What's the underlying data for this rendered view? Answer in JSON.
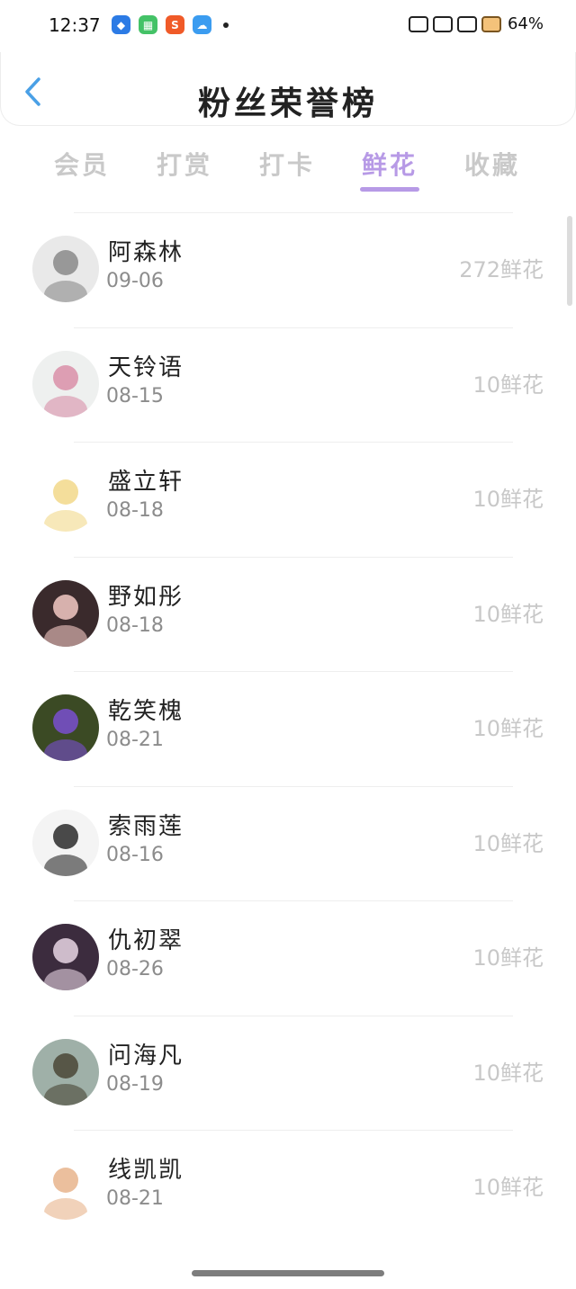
{
  "status_bar": {
    "time": "12:37",
    "battery": "64%",
    "app_icons": [
      {
        "name": "browser-icon",
        "color": "#2c7be5",
        "glyph": "◆"
      },
      {
        "name": "grid-app-icon",
        "color": "#44c267",
        "glyph": "▦"
      },
      {
        "name": "s-app-icon",
        "color": "#f05a28",
        "glyph": "S"
      },
      {
        "name": "weather-icon",
        "color": "#3b9cf0",
        "glyph": "☁"
      }
    ]
  },
  "header": {
    "title": "粉丝荣誉榜"
  },
  "tabs": [
    {
      "label": "会员",
      "active": false
    },
    {
      "label": "打赏",
      "active": false
    },
    {
      "label": "打卡",
      "active": false
    },
    {
      "label": "鲜花",
      "active": true
    },
    {
      "label": "收藏",
      "active": false
    }
  ],
  "colors": {
    "accent": "#b79ae6",
    "back_arrow": "#4aa0e6"
  },
  "fans": [
    {
      "name": "阿森林",
      "date": "09-06",
      "amount": "272鲜花",
      "avatar": "anime-girl-sketch-avatar",
      "bg": "#e9e9e9",
      "fg": "#8a8a8a"
    },
    {
      "name": "天铃语",
      "date": "08-15",
      "amount": "10鲜花",
      "avatar": "flower-earrings-avatar",
      "bg": "#eef0ef",
      "fg": "#d98fa8"
    },
    {
      "name": "盛立轩",
      "date": "08-18",
      "amount": "10鲜花",
      "avatar": "cute-chick-avatar",
      "bg": "#ffffff",
      "fg": "#f2d88a"
    },
    {
      "name": "野如彤",
      "date": "08-18",
      "amount": "10鲜花",
      "avatar": "illustrated-girl-avatar",
      "bg": "#3a2a2c",
      "fg": "#f3c9c4"
    },
    {
      "name": "乾笑槐",
      "date": "08-21",
      "amount": "10鲜花",
      "avatar": "purple-iris-avatar",
      "bg": "#3b4a24",
      "fg": "#7a4fd0"
    },
    {
      "name": "索雨莲",
      "date": "08-16",
      "amount": "10鲜花",
      "avatar": "tiger-sketch-avatar",
      "bg": "#f4f4f4",
      "fg": "#2a2a2a"
    },
    {
      "name": "仇初翠",
      "date": "08-26",
      "amount": "10鲜花",
      "avatar": "dark-anime-avatar",
      "bg": "#3c2c3e",
      "fg": "#e8d6e4"
    },
    {
      "name": "问海凡",
      "date": "08-19",
      "amount": "10鲜花",
      "avatar": "sunset-sky-avatar",
      "bg": "#9fb0a8",
      "fg": "#4a4636"
    },
    {
      "name": "线凯凯",
      "date": "08-21",
      "amount": "10鲜花",
      "avatar": "cartoon-girl-avatar",
      "bg": "#ffffff",
      "fg": "#e7b48c"
    }
  ]
}
